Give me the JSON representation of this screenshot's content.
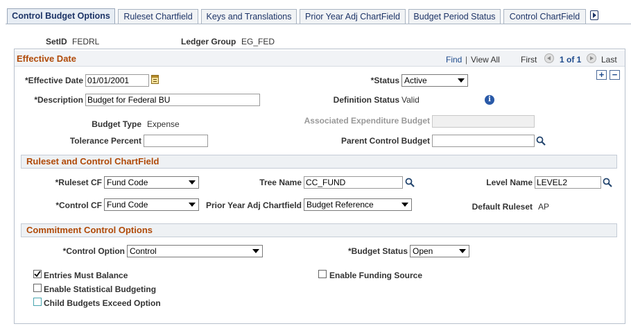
{
  "tabs": [
    {
      "label": "Control Budget Options"
    },
    {
      "label": "Ruleset Chartfield"
    },
    {
      "label": "Keys and Translations"
    },
    {
      "label": "Prior Year Adj ChartField"
    },
    {
      "label": "Budget Period Status"
    },
    {
      "label": "Control ChartField"
    }
  ],
  "header": {
    "setid_label": "SetID",
    "setid_value": "FEDRL",
    "ledger_group_label": "Ledger Group",
    "ledger_group_value": "EG_FED"
  },
  "effective_date_section": {
    "title": "Effective Date",
    "find_label": "Find",
    "separator": "|",
    "view_all_label": "View All",
    "first_label": "First",
    "paging_text": "1 of 1",
    "last_label": "Last",
    "add_row_symbol": "+",
    "delete_row_symbol": "−",
    "effective_date_label": "*Effective Date",
    "effective_date_value": "01/01/2001",
    "status_label": "*Status",
    "status_value": "Active",
    "description_label": "*Description",
    "description_value": "Budget for Federal BU",
    "definition_status_label": "Definition Status",
    "definition_status_value": "Valid",
    "budget_type_label": "Budget Type",
    "budget_type_value": "Expense",
    "assoc_exp_budget_label": "Associated Expenditure Budget",
    "assoc_exp_budget_value": "",
    "tolerance_percent_label": "Tolerance Percent",
    "tolerance_percent_value": "",
    "parent_control_budget_label": "Parent Control Budget",
    "parent_control_budget_value": ""
  },
  "ruleset_section": {
    "title": "Ruleset and Control ChartField",
    "ruleset_cf_label": "*Ruleset CF",
    "ruleset_cf_value": "Fund Code",
    "tree_name_label": "Tree Name",
    "tree_name_value": "CC_FUND",
    "level_name_label": "Level Name",
    "level_name_value": "LEVEL2",
    "control_cf_label": "*Control CF",
    "control_cf_value": "Fund Code",
    "prior_year_adj_label": "Prior Year Adj Chartfield",
    "prior_year_adj_value": "Budget Reference",
    "default_ruleset_label": "Default Ruleset",
    "default_ruleset_value": "AP"
  },
  "commitment_section": {
    "title": "Commitment Control Options",
    "control_option_label": "*Control Option",
    "control_option_value": "Control",
    "budget_status_label": "*Budget Status",
    "budget_status_value": "Open",
    "entries_must_balance_label": "Entries Must Balance",
    "entries_must_balance_checked": true,
    "enable_funding_source_label": "Enable Funding Source",
    "enable_funding_source_checked": false,
    "enable_stat_budgeting_label": "Enable Statistical Budgeting",
    "enable_stat_budgeting_checked": false,
    "child_budgets_exceed_label": "Child Budgets Exceed Option",
    "child_budgets_exceed_checked": false
  },
  "colors": {
    "section_title": "#b04a08",
    "link": "#1d4a8c",
    "tab_text": "#1d3467"
  }
}
